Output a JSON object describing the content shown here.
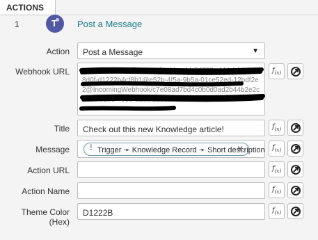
{
  "section": {
    "title": "ACTIONS"
  },
  "step": {
    "number": "1",
    "title": "Post a Message",
    "icon": "teams-icon",
    "icon_color": "#5258a4"
  },
  "fields": {
    "action": {
      "label": "Action",
      "value": "Post a Message"
    },
    "webhook_url": {
      "label": "Webhook URL",
      "value": "https://outlook.office.com/webhook/c24708ad-bb4d-4d02-8d0f-d1222b4cf8b1@e52b-4f5a-9b5a-01ce52ed-12bdf2e2@IncomingWebhook/c7e08ad7bd4c0b0d0ad2b44b2e2c18bd/e2e8-403e-92dc-58de7312cf07",
      "redacted": true
    },
    "title": {
      "label": "Title",
      "value": "Check out this new Knowledge article!"
    },
    "message": {
      "label": "Message",
      "pill": [
        "Trigger",
        "Knowledge Record",
        "Short description"
      ],
      "pill_separator": "➛"
    },
    "action_url": {
      "label": "Action URL",
      "value": ""
    },
    "action_name": {
      "label": "Action Name",
      "value": ""
    },
    "theme_color": {
      "label": "Theme Color (Hex)",
      "value": "D1222B"
    }
  },
  "buttons": {
    "fx_label": "f(x)",
    "fx_icon": "function-icon",
    "pill_icon": "data-pill-picker-icon"
  },
  "colors": {
    "accent": "#1b7a8c",
    "border": "#bdbdbd",
    "redaction": "#000000"
  }
}
